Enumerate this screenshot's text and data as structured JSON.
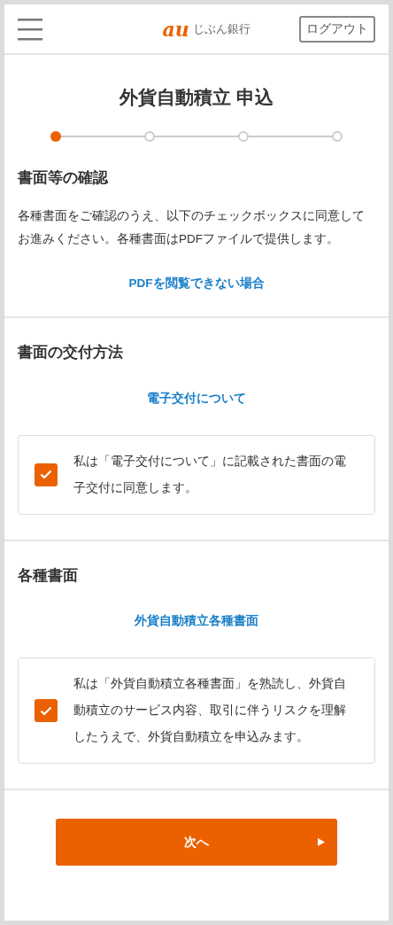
{
  "header": {
    "logo_mark": "au",
    "logo_text": "じぶん銀行",
    "logout_button": "ログアウト"
  },
  "title": "外貨自動積立 申込",
  "steps": [
    {
      "selected": true
    },
    {
      "selected": false
    },
    {
      "selected": false
    },
    {
      "selected": false
    }
  ],
  "sections": [
    {
      "heading": "書面等の確認",
      "description": "各種書面をご確認のうえ、以下のチェックボックスに同意してお進みください。各種書面はPDFファイルで提供します。",
      "link": "PDFを閲覧できない場合"
    },
    {
      "heading": "書面の交付方法",
      "link": "電子交付について",
      "agreement": {
        "text": "私は「電子交付について」に記載された書面の電子交付に同意します。",
        "checked": true
      }
    },
    {
      "heading": "各種書面",
      "link": "外貨自動積立各種書面",
      "agreement": {
        "text": "私は「外貨自動積立各種書面」を熟読し、外貨自動積立のサービス内容、取引に伴うリスクを理解したうえで、外貨自動積立を申込みます。",
        "checked": true
      }
    }
  ],
  "next_button": "次へ"
}
